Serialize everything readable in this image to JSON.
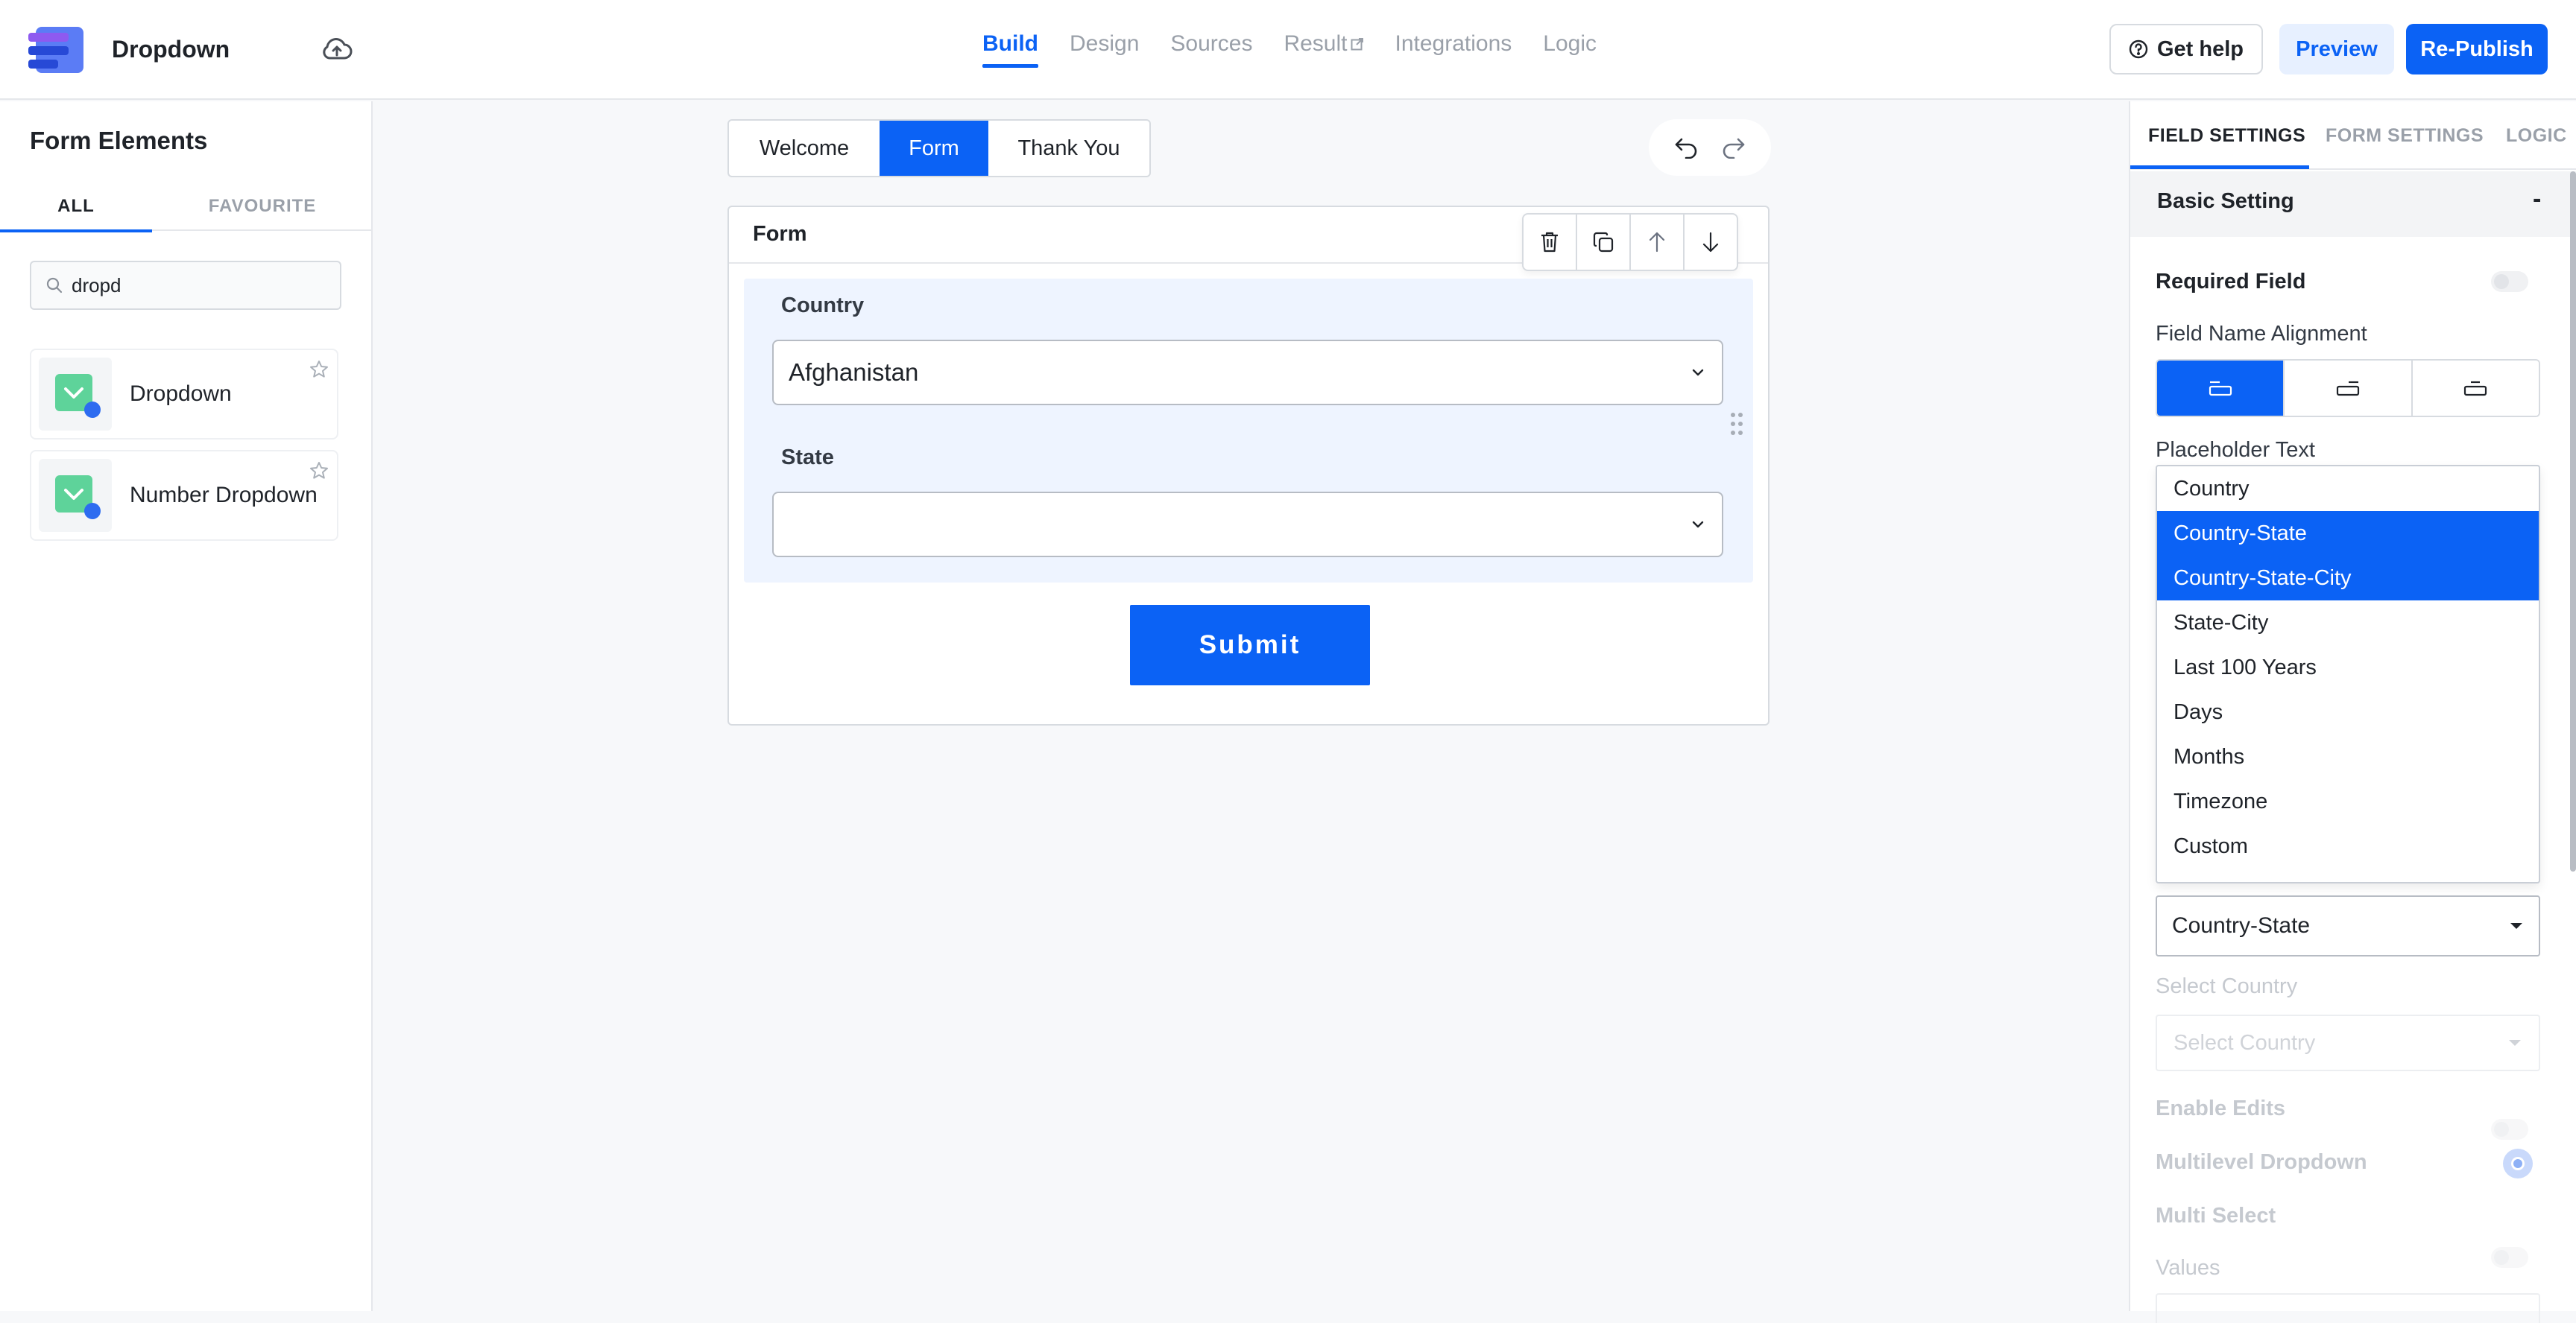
{
  "header": {
    "form_title": "Dropdown",
    "tabs": [
      {
        "label": "Build",
        "active": true
      },
      {
        "label": "Design"
      },
      {
        "label": "Sources"
      },
      {
        "label": "Result",
        "external": true
      },
      {
        "label": "Integrations"
      },
      {
        "label": "Logic"
      }
    ],
    "help_label": "Get help",
    "preview_label": "Preview",
    "publish_label": "Re-Publish"
  },
  "left_panel": {
    "title": "Form Elements",
    "tab_all": "ALL",
    "tab_favourite": "FAVOURITE",
    "search_value": "dropd",
    "elements": [
      {
        "label": "Dropdown"
      },
      {
        "label": "Number Dropdown"
      }
    ]
  },
  "canvas": {
    "steps": [
      {
        "label": "Welcome"
      },
      {
        "label": "Form",
        "active": true
      },
      {
        "label": "Thank You"
      }
    ],
    "form_title": "Form",
    "fields": [
      {
        "label": "Country",
        "value": "Afghanistan"
      },
      {
        "label": "State",
        "value": ""
      }
    ],
    "submit_label": "Submit"
  },
  "right_panel": {
    "tabs": [
      "FIELD SETTINGS",
      "FORM SETTINGS",
      "LOGIC"
    ],
    "section_title": "Basic Setting",
    "collapse_symbol": "-",
    "required_label": "Required Field",
    "alignment_label": "Field Name Alignment",
    "placeholder_label": "Placeholder Text",
    "dropdown_options": [
      {
        "label": "Country"
      },
      {
        "label": "Country-State",
        "selected": true
      },
      {
        "label": "Country-State-City",
        "selected": true
      },
      {
        "label": "State-City"
      },
      {
        "label": "Last 100 Years"
      },
      {
        "label": "Days"
      },
      {
        "label": "Months"
      },
      {
        "label": "Timezone"
      },
      {
        "label": "Custom"
      }
    ],
    "source_value": "Country-State",
    "select_country_label": "Select Country",
    "select_country_placeholder": "Select Country",
    "enable_edits_label": "Enable Edits",
    "multilevel_label": "Multilevel Dropdown",
    "multiselect_label": "Multi Select",
    "values_label": "Values"
  },
  "colors": {
    "accent": "#0b62f5",
    "selection": "#0b62f5",
    "field_group_bg": "#eef4ff"
  }
}
